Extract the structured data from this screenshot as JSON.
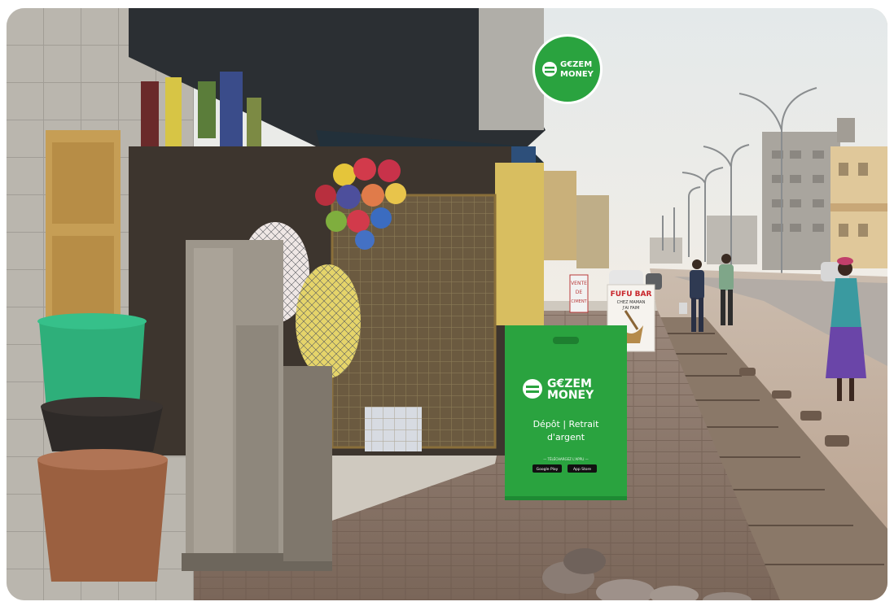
{
  "brand": {
    "name_line1": "G€ZEM",
    "name_line2": "MONEY",
    "color_green": "#2aa33f",
    "color_white": "#ffffff"
  },
  "board": {
    "tagline_line1": "Dépôt | Retrait",
    "tagline_line2": "d'argent",
    "download_label": "— TÉLÉCHARGEZ L'APPLI —",
    "badge_google": "Google Play",
    "badge_apple": "App Store"
  },
  "street_signs": {
    "vente_line1": "VENTE",
    "vente_line2": "DE",
    "vente_line3": "CIMENT",
    "fufu_line1": "FUFU BAR",
    "fufu_line2": "CHEZ MAMAN",
    "fufu_line3": "J'AI FAIM"
  },
  "scene": {
    "sky_color": "#e9ecea",
    "road_color": "#c9b7a6",
    "pavement_color": "#8f7c70",
    "wall_color": "#b8b4ac",
    "awning_color": "#2b2f33"
  }
}
